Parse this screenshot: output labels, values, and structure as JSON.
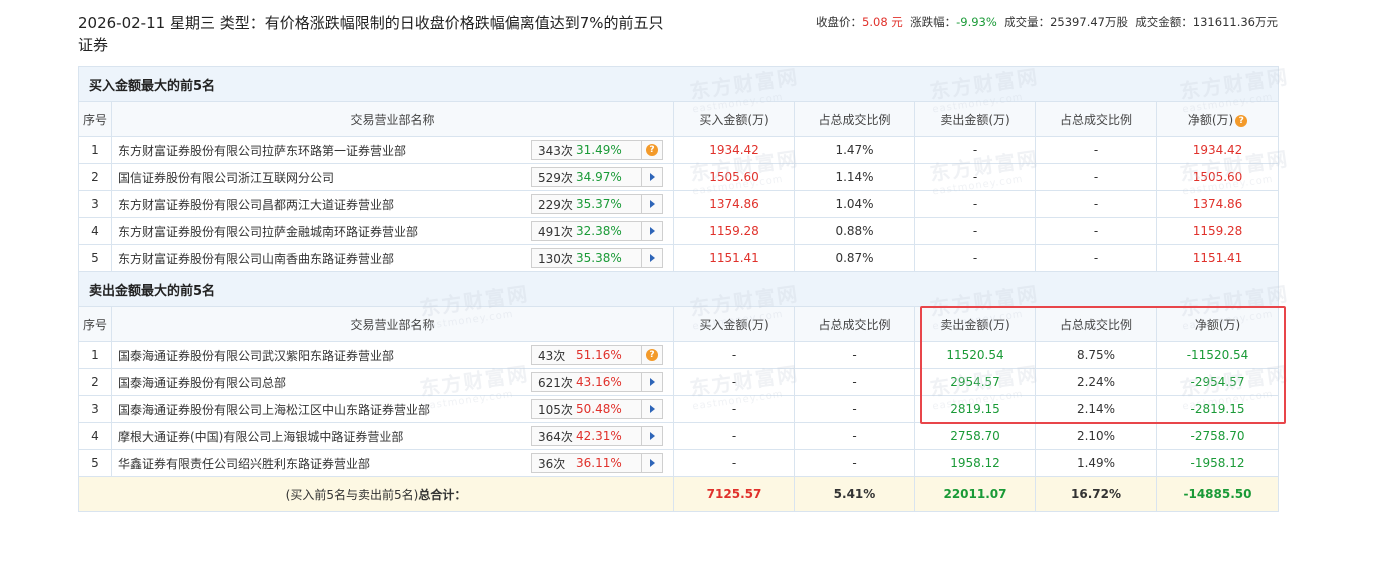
{
  "header": {
    "title": "2026-02-11 星期三 类型：有价格涨跌幅限制的日收盘价格跌幅偏离值达到7%的前五只证券",
    "close_label": "收盘价：",
    "close_value": "5.08 元",
    "change_label": "涨跌幅：",
    "change_value": "-9.93%",
    "volume_label": "成交量：",
    "volume_value": "25397.47万股",
    "amount_label": "成交金额：",
    "amount_value": "131611.36万元"
  },
  "watermark": {
    "cn": "东方财富网",
    "en": "eastmoney.com"
  },
  "columns": [
    "序号",
    "交易营业部名称",
    "买入金额(万)",
    "占总成交比例",
    "卖出金额(万)",
    "占总成交比例",
    "净额(万)"
  ],
  "buy_section": {
    "title": "买入金额最大的前5名",
    "rows": [
      {
        "idx": "1",
        "name": "东方财富证券股份有限公司拉萨东环路第一证券营业部",
        "times": "343次",
        "rate": "31.49%",
        "icon": "question-icon",
        "buy": "1934.42",
        "buy_pct": "1.47%",
        "sell": "-",
        "sell_pct": "-",
        "net": "1934.42"
      },
      {
        "idx": "2",
        "name": "国信证券股份有限公司浙江互联网分公司",
        "times": "529次",
        "rate": "34.97%",
        "icon": "arrow-right-icon",
        "buy": "1505.60",
        "buy_pct": "1.14%",
        "sell": "-",
        "sell_pct": "-",
        "net": "1505.60"
      },
      {
        "idx": "3",
        "name": "东方财富证券股份有限公司昌都两江大道证券营业部",
        "times": "229次",
        "rate": "35.37%",
        "icon": "arrow-right-icon",
        "buy": "1374.86",
        "buy_pct": "1.04%",
        "sell": "-",
        "sell_pct": "-",
        "net": "1374.86"
      },
      {
        "idx": "4",
        "name": "东方财富证券股份有限公司拉萨金融城南环路证券营业部",
        "times": "491次",
        "rate": "32.38%",
        "icon": "arrow-right-icon",
        "buy": "1159.28",
        "buy_pct": "0.88%",
        "sell": "-",
        "sell_pct": "-",
        "net": "1159.28"
      },
      {
        "idx": "5",
        "name": "东方财富证券股份有限公司山南香曲东路证券营业部",
        "times": "130次",
        "rate": "35.38%",
        "icon": "arrow-right-icon",
        "buy": "1151.41",
        "buy_pct": "0.87%",
        "sell": "-",
        "sell_pct": "-",
        "net": "1151.41"
      }
    ]
  },
  "sell_section": {
    "title": "卖出金额最大的前5名",
    "rows": [
      {
        "idx": "1",
        "name": "国泰海通证券股份有限公司武汉紫阳东路证券营业部",
        "times": "43次",
        "rate": "51.16%",
        "icon": "question-icon",
        "buy": "-",
        "buy_pct": "-",
        "sell": "11520.54",
        "sell_pct": "8.75%",
        "net": "-11520.54"
      },
      {
        "idx": "2",
        "name": "国泰海通证券股份有限公司总部",
        "times": "621次",
        "rate": "43.16%",
        "icon": "arrow-right-icon",
        "buy": "-",
        "buy_pct": "-",
        "sell": "2954.57",
        "sell_pct": "2.24%",
        "net": "-2954.57"
      },
      {
        "idx": "3",
        "name": "国泰海通证券股份有限公司上海松江区中山东路证券营业部",
        "times": "105次",
        "rate": "50.48%",
        "icon": "arrow-right-icon",
        "buy": "-",
        "buy_pct": "-",
        "sell": "2819.15",
        "sell_pct": "2.14%",
        "net": "-2819.15"
      },
      {
        "idx": "4",
        "name": "摩根大通证券(中国)有限公司上海银城中路证券营业部",
        "times": "364次",
        "rate": "42.31%",
        "icon": "arrow-right-icon",
        "buy": "-",
        "buy_pct": "-",
        "sell": "2758.70",
        "sell_pct": "2.10%",
        "net": "-2758.70"
      },
      {
        "idx": "5",
        "name": "华鑫证券有限责任公司绍兴胜利东路证券营业部",
        "times": "36次",
        "rate": "36.11%",
        "icon": "arrow-right-icon",
        "buy": "-",
        "buy_pct": "-",
        "sell": "1958.12",
        "sell_pct": "1.49%",
        "net": "-1958.12"
      }
    ]
  },
  "total": {
    "label_prefix": "(买入前5名与卖出前5名)",
    "label_bold": "总合计：",
    "buy": "7125.57",
    "buy_pct": "5.41%",
    "sell": "22011.07",
    "sell_pct": "16.72%",
    "net": "-14885.50"
  },
  "colors": {
    "up": "#e0312b",
    "down": "#1a9a37",
    "highlight": "#e8454a"
  }
}
